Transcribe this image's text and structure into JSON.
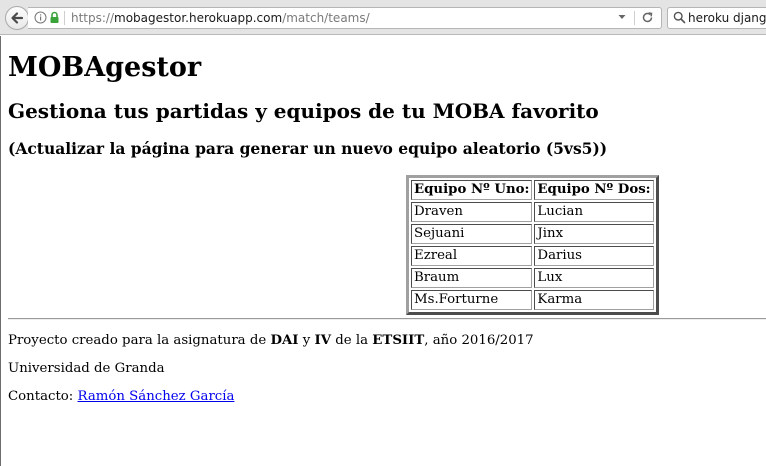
{
  "browser": {
    "url_scheme": "https://",
    "url_host": "mobagestor.herokuapp.com",
    "url_path": "/match/teams/",
    "search_text": "heroku django"
  },
  "page": {
    "title": "MOBAgestor",
    "subtitle": "Gestiona tus partidas y equipos de tu MOBA favorito",
    "hint": "(Actualizar la página para generar un nuevo equipo aleatorio (5vs5))",
    "table": {
      "headers": [
        "Equipo Nº Uno:",
        "Equipo Nº Dos:"
      ],
      "rows": [
        [
          "Draven",
          "Lucian"
        ],
        [
          "Sejuani",
          "Jinx"
        ],
        [
          "Ezreal",
          "Darius"
        ],
        [
          "Braum",
          "Lux"
        ],
        [
          "Ms.Forturne",
          "Karma"
        ]
      ]
    },
    "footer": {
      "line1_prefix": "Proyecto creado para la asignatura de ",
      "line1_dai": "DAI",
      "line1_y": " y ",
      "line1_iv": "IV",
      "line1_dela": " de la ",
      "line1_etsiit": "ETSIIT",
      "line1_suffix": ", año 2016/2017",
      "line2": "Universidad de Granda",
      "contact_label": "Contacto: ",
      "contact_name": "Ramón Sánchez García"
    }
  },
  "colors": {
    "link": "#0000ee",
    "chrome_bg": "#e4e4e4",
    "secure_lock": "#3aa33a"
  }
}
